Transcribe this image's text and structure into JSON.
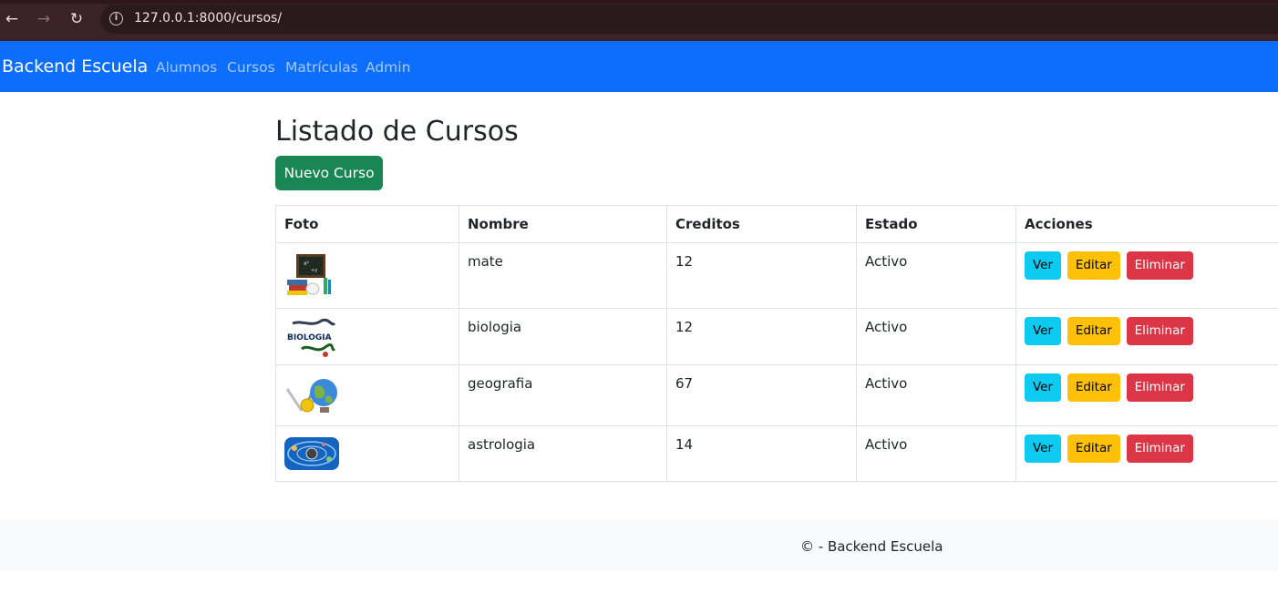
{
  "browser": {
    "url": "127.0.0.1:8000/cursos/",
    "back_icon": "←",
    "forward_icon": "→",
    "reload_icon": "↻",
    "info_icon": "i"
  },
  "navbar": {
    "brand": "Backend Escuela",
    "links": [
      "Alumnos",
      "Cursos",
      "Matrículas",
      "Admin"
    ]
  },
  "main": {
    "title": "Listado de Cursos",
    "new_button": "Nuevo Curso",
    "table": {
      "headers": [
        "Foto",
        "Nombre",
        "Creditos",
        "Estado",
        "Acciones"
      ],
      "rows": [
        {
          "foto": "chalkboard-books-image",
          "nombre": "mate",
          "creditos": "12",
          "estado": "Activo"
        },
        {
          "foto": "biologia-dna-image",
          "nombre": "biologia",
          "creditos": "12",
          "estado": "Activo"
        },
        {
          "foto": "globe-compass-image",
          "nombre": "geografia",
          "creditos": "67",
          "estado": "Activo"
        },
        {
          "foto": "solar-system-image",
          "nombre": "astrologia",
          "creditos": "14",
          "estado": "Activo"
        }
      ],
      "actions": {
        "ver": "Ver",
        "editar": "Editar",
        "eliminar": "Eliminar"
      },
      "thumb_text_biologia": "BIOLOGIA"
    }
  },
  "footer": {
    "text": "© - Backend Escuela"
  },
  "colors": {
    "navbar": "#0d6efd",
    "success": "#198754",
    "info": "#0dcaf0",
    "warning": "#ffc107",
    "danger": "#dc3545"
  }
}
